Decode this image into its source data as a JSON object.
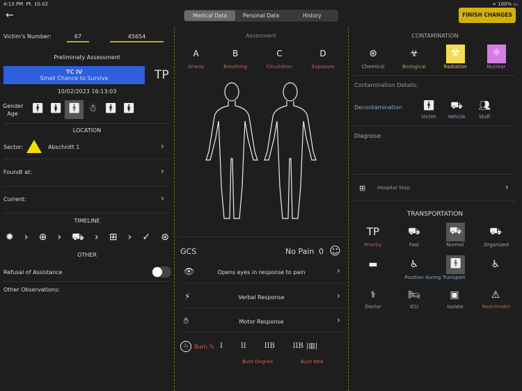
{
  "status": {
    "time": "4:13 PM",
    "date": "Pt. 10.02",
    "battery": "100%"
  },
  "tabs": [
    "Medical Data",
    "Personal Data",
    "History"
  ],
  "finish": "FINISH CHANGES",
  "left": {
    "victim_label": "Victim's Number:",
    "victim_num1": "67",
    "victim_num2": "45654",
    "prelim": "Preliminaty Assessment",
    "tc": "TC IV",
    "tc_sub": "Small Chance to Survive",
    "tp": "TP",
    "datetime": "10/02/2023 16:13:03",
    "gender": "Gender",
    "age": "Age",
    "location": "LOCATION",
    "sector_label": "Sector:",
    "sector_value": "Abschnitt 1",
    "found": "Foundt at:",
    "current": "Current:",
    "timeline": "TIMELINE",
    "other": "OTHER",
    "refusal": "Refusal of Assistance",
    "observations": "Other Observations:"
  },
  "middle": {
    "assessment": "Assesment",
    "abcd": [
      {
        "l": "A",
        "t": "Airway"
      },
      {
        "l": "B",
        "t": "Breathing"
      },
      {
        "l": "C",
        "t": "Circulation"
      },
      {
        "l": "D",
        "t": "Exposure"
      }
    ],
    "gcs": "GCS",
    "pain": "No Pain",
    "pain_val": "0",
    "eyes": "Opens eyes in response to pain",
    "verbal": "Verbal Response",
    "motor": "Motor Response",
    "burn": "Burn %",
    "degrees": [
      "I",
      "II",
      "IIB",
      "IIB"
    ],
    "burn_degree": "Burn Degree",
    "burn_bed": "Burn Bed"
  },
  "right": {
    "contamination": "CONTAMINATION",
    "types": [
      "Chemical",
      "Biological",
      "Radiation",
      "Nuclear"
    ],
    "details": "Contamination Details:",
    "decon": "Decontamination",
    "decon_opts": [
      "Victim",
      "Vehicle",
      "Staff"
    ],
    "diagnose": "Diagnose:",
    "hospital": "Hospital Stay:",
    "transport": "TRANSPORTATION",
    "t_row1": [
      "Priority",
      "Fast",
      "Normal",
      "Organized"
    ],
    "position": "Position during Transport",
    "t_row3": [
      "Doctor",
      "ICU",
      "Isolate",
      "Reanimate!"
    ]
  }
}
